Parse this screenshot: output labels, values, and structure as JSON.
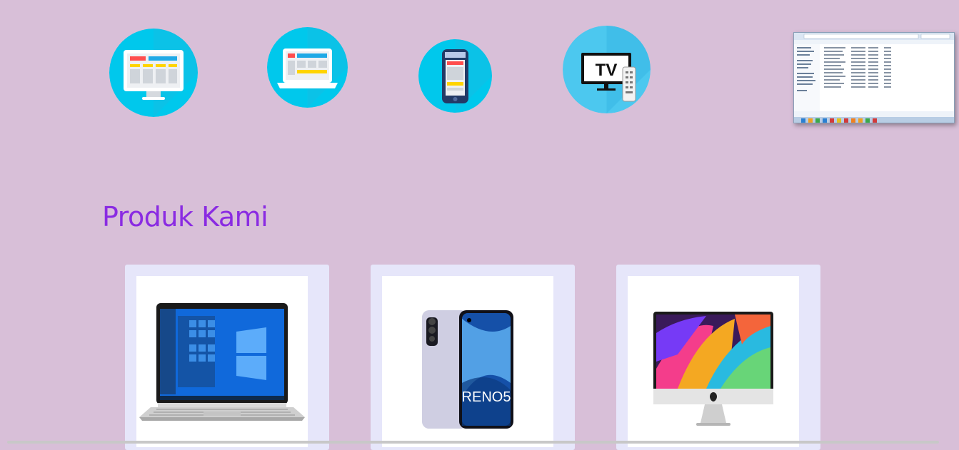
{
  "categories": [
    {
      "icon": "desktop-monitor-icon"
    },
    {
      "icon": "laptop-icon"
    },
    {
      "icon": "smartphone-icon"
    },
    {
      "icon": "tv-remote-icon",
      "label": "TV"
    }
  ],
  "colors": {
    "page_background": "#d8bfd8",
    "title_color": "#8a2be2",
    "card_background": "#e6e6fa",
    "icon_circle": "#00c8ec"
  },
  "section": {
    "title": "Produk Kami"
  },
  "products": [
    {
      "image": "hp-laptop-image"
    },
    {
      "image": "oppo-reno5-image",
      "brand_text": "RENO5"
    },
    {
      "image": "imac-image"
    }
  ]
}
